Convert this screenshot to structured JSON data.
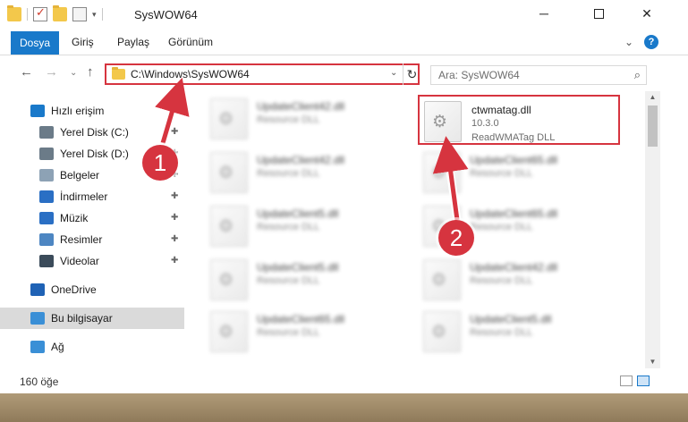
{
  "window": {
    "title": "SysWOW64",
    "minimize": "─",
    "close": "✕"
  },
  "ribbon": {
    "tabs": [
      "Dosya",
      "Giriş",
      "Paylaş",
      "Görünüm"
    ],
    "expand_glyph": "⌄",
    "help_glyph": "?"
  },
  "nav": {
    "back_glyph": "←",
    "forward_glyph": "→",
    "recent_glyph": "⌄",
    "up_glyph": "↑"
  },
  "address": {
    "path": "C:\\Windows\\SysWOW64",
    "dropdown_glyph": "⌄",
    "refresh_glyph": "↻"
  },
  "search": {
    "placeholder": "Ara: SysWOW64",
    "icon_glyph": "⌕"
  },
  "sidebar": {
    "items": [
      {
        "label": "Hızlı erişim",
        "icon": "star-icon",
        "color": "#1979ca",
        "pinned": false
      },
      {
        "label": "Yerel Disk (C:)",
        "icon": "drive-icon",
        "color": "#6b7b88",
        "pinned": true
      },
      {
        "label": "Yerel Disk (D:)",
        "icon": "drive-icon",
        "color": "#6b7b88",
        "pinned": true
      },
      {
        "label": "Belgeler",
        "icon": "documents-icon",
        "color": "#8da2b5",
        "pinned": true
      },
      {
        "label": "İndirmeler",
        "icon": "download-icon",
        "color": "#2a6fc4",
        "pinned": true
      },
      {
        "label": "Müzik",
        "icon": "music-icon",
        "color": "#2a6fc4",
        "pinned": true
      },
      {
        "label": "Resimler",
        "icon": "pictures-icon",
        "color": "#4d86c2",
        "pinned": true
      },
      {
        "label": "Videolar",
        "icon": "videos-icon",
        "color": "#3b4b5a",
        "pinned": true
      },
      {
        "label": "OneDrive",
        "icon": "onedrive-icon",
        "color": "#1f62b5",
        "pinned": false
      },
      {
        "label": "Bu bilgisayar",
        "icon": "computer-icon",
        "color": "#3a8fd6",
        "pinned": false
      },
      {
        "label": "Ağ",
        "icon": "network-icon",
        "color": "#3a8fd6",
        "pinned": false
      }
    ],
    "pin_glyph": "📌"
  },
  "files": {
    "highlighted": {
      "name": "ctwmatag.dll",
      "version": "10.3.0",
      "description": "ReadWMATag DLL"
    },
    "blurred_left": [
      {
        "name": "UpdateClient42.dll",
        "type": "Resource DLL"
      },
      {
        "name": "UpdateClient42.dll",
        "type": "Resource DLL"
      },
      {
        "name": "UpdateClient5.dll",
        "type": "Resource DLL"
      },
      {
        "name": "UpdateClient5.dll",
        "type": "Resource DLL"
      },
      {
        "name": "UpdateClient65.dll",
        "type": "Resource DLL"
      }
    ],
    "blurred_right": [
      {
        "name": "UpdateClient65.dll",
        "type": "Resource DLL"
      },
      {
        "name": "UpdateClient65.dll",
        "type": "Resource DLL"
      },
      {
        "name": "UpdateClient42.dll",
        "type": "Resource DLL"
      },
      {
        "name": "UpdateClient5.dll",
        "type": "Resource DLL"
      }
    ]
  },
  "status": {
    "item_count": "160 öğe"
  },
  "annotations": {
    "step1": "1",
    "step2": "2",
    "accent": "#d6343f"
  }
}
